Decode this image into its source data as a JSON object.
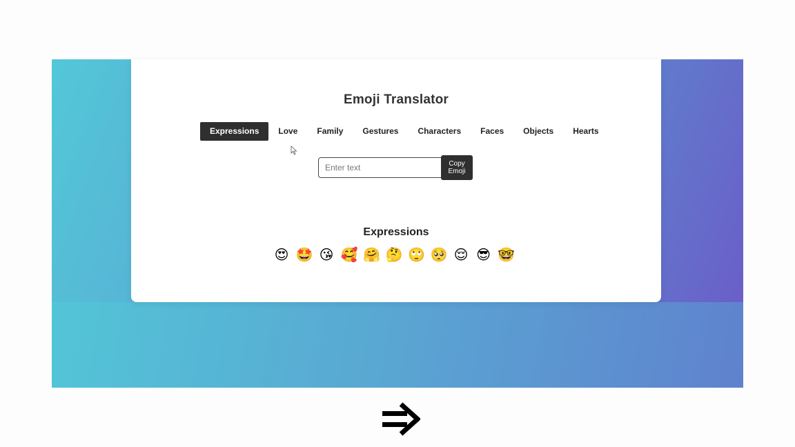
{
  "app": {
    "title": "Emoji Translator"
  },
  "tabs": [
    {
      "label": "Expressions",
      "active": true
    },
    {
      "label": "Love",
      "active": false
    },
    {
      "label": "Family",
      "active": false
    },
    {
      "label": "Gestures",
      "active": false
    },
    {
      "label": "Characters",
      "active": false
    },
    {
      "label": "Faces",
      "active": false
    },
    {
      "label": "Objects",
      "active": false
    },
    {
      "label": "Hearts",
      "active": false
    }
  ],
  "input": {
    "placeholder": "Enter text",
    "value": ""
  },
  "copy_button": {
    "line1": "Copy",
    "line2": "Emoji"
  },
  "section": {
    "title": "Expressions",
    "emojis": [
      "😍",
      "🤩",
      "😘",
      "🥰",
      "🤗",
      "🤔",
      "🙄",
      "🥺",
      "😌",
      "😎",
      "🤓"
    ]
  },
  "colors": {
    "accent_dark": "#2f2f2f",
    "gradient_start": "#53c7d8",
    "gradient_end": "#6a5fc8",
    "card_bg": "#ffffff"
  },
  "icons": {
    "cursor": "mouse-pointer-icon",
    "arrow": "double-right-arrow-icon"
  }
}
